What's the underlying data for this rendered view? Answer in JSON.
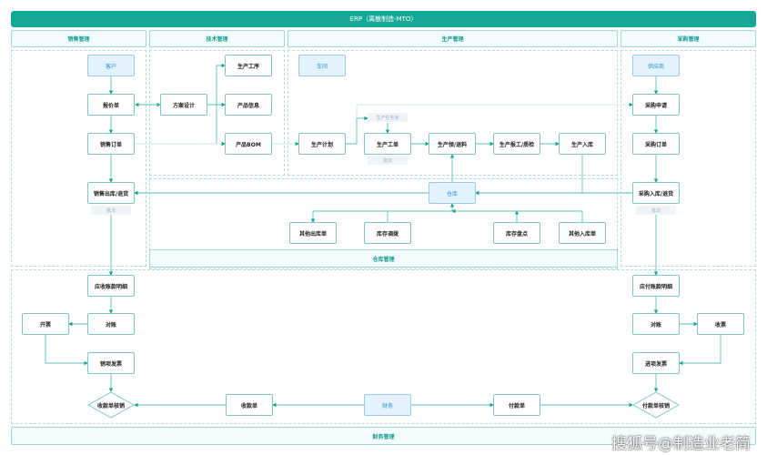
{
  "title": "ERP（离散制造-MTO）",
  "sections": {
    "sales": "销售管理",
    "tech": "技术管理",
    "production": "生产管理",
    "purchase": "采购管理",
    "warehouse": "仓库管理",
    "finance": "财务管理"
  },
  "nodes": {
    "customer": "客户",
    "quote": "报价单",
    "sales_order": "销售订单",
    "sales_out": "销售出库/退货",
    "solution": "方案设计",
    "process": "生产工序",
    "product_info": "产品信息",
    "bom": "产品BOM",
    "workshop": "车间",
    "plan": "生产计划",
    "work_order": "生产工单",
    "material": "生产领/退料",
    "report": "生产报工/质检",
    "prod_in": "生产入库",
    "warehouse": "仓库",
    "other_out": "其他出库单",
    "transfer": "库存调拨",
    "stocktake": "库存盘点",
    "other_in": "其他入库单",
    "supplier": "供应商",
    "pur_req": "采购申请",
    "pur_order": "采购订单",
    "pur_in": "采购入库/退货",
    "ar": "应收账款明细",
    "invoice_out": "开票",
    "ar_check": "对账",
    "sales_invoice": "销项发票",
    "receipt_verify": "收款单核销",
    "receipt": "收款单",
    "finance": "财务",
    "payment": "付款单",
    "payment_verify": "付款单核销",
    "ap": "应付账款明细",
    "ap_check": "对账",
    "invoice_in": "收票",
    "input_invoice": "进项发票"
  },
  "tags": {
    "batch": "批次",
    "task_pool": "生产任务池"
  },
  "watermark": "搜狐号@制造业老简"
}
